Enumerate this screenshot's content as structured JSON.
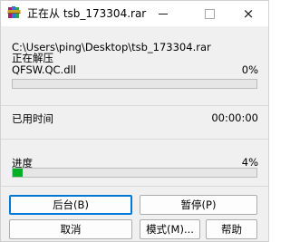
{
  "window": {
    "title": "正在从 tsb_173304.rar",
    "icon": "winrar-books-icon",
    "controls": {
      "minimize": "minimize-icon",
      "maximize": "maximize-icon",
      "close": "×"
    }
  },
  "extract": {
    "path": "C:\\Users\\ping\\Desktop\\tsb_173304.rar",
    "status": "正在解压",
    "current_file": "QFSW.QC.dll",
    "file_percent": "0%",
    "file_progress": 0.0
  },
  "time": {
    "elapsed_label": "已用时间",
    "elapsed_value": "00:00:00"
  },
  "overall": {
    "label": "进度",
    "percent": "4%",
    "progress": 0.04
  },
  "buttons": {
    "background": "后台(B)",
    "pause": "暂停(P)",
    "cancel": "取消",
    "mode": "模式(M)...",
    "help": "帮助"
  },
  "colors": {
    "progress_fill": "#06b025",
    "focus_border": "#0078d7"
  }
}
